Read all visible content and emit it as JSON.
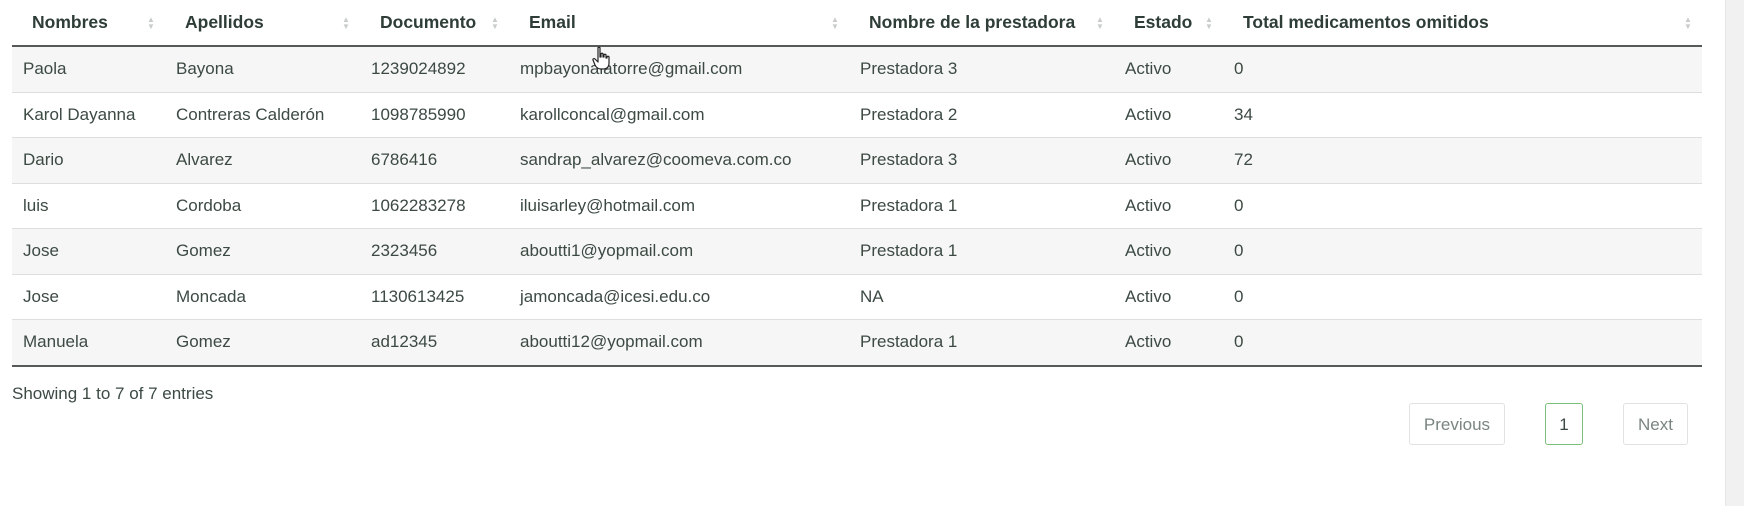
{
  "table": {
    "columns": [
      "Nombres",
      "Apellidos",
      "Documento",
      "Email",
      "Nombre de la prestadora",
      "Estado",
      "Total medicamentos omitidos"
    ],
    "rows": [
      [
        "Paola",
        "Bayona",
        "1239024892",
        "mpbayonalatorre@gmail.com",
        "Prestadora 3",
        "Activo",
        "0"
      ],
      [
        "Karol Dayanna",
        "Contreras Calderón",
        "1098785990",
        "karollconcal@gmail.com",
        "Prestadora 2",
        "Activo",
        "34"
      ],
      [
        "Dario",
        "Alvarez",
        "6786416",
        "sandrap_alvarez@coomeva.com.co",
        "Prestadora 3",
        "Activo",
        "72"
      ],
      [
        "luis",
        "Cordoba",
        "1062283278",
        "iluisarley@hotmail.com",
        "Prestadora 1",
        "Activo",
        "0"
      ],
      [
        "Jose",
        "Gomez",
        "2323456",
        "aboutti1@yopmail.com",
        "Prestadora 1",
        "Activo",
        "0"
      ],
      [
        "Jose",
        "Moncada",
        "1130613425",
        "jamoncada@icesi.edu.co",
        "NA",
        "Activo",
        "0"
      ],
      [
        "Manuela",
        "Gomez",
        "ad12345",
        "aboutti12@yopmail.com",
        "Prestadora 1",
        "Activo",
        "0"
      ]
    ]
  },
  "info": {
    "text": "Showing 1 to 7 of 7 entries"
  },
  "pagination": {
    "previous_label": "Previous",
    "current_page": "1",
    "next_label": "Next"
  },
  "icons": {
    "sort": "sort-both-icon",
    "cursor": "hand-pointer-icon"
  },
  "colors": {
    "active_page_border": "#7cbf7a",
    "striped_row": "#f6f6f6",
    "header_rule": "#555a57"
  }
}
